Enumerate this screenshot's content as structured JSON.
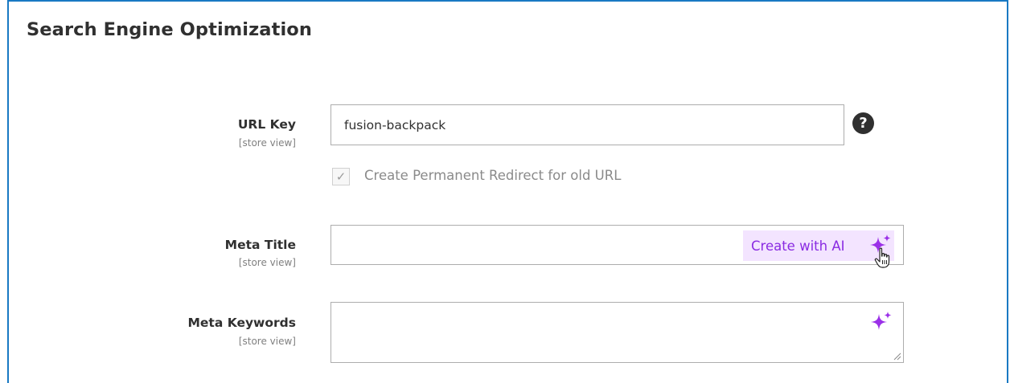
{
  "section": {
    "title": "Search Engine Optimization"
  },
  "fields": {
    "url_key": {
      "label": "URL Key",
      "scope": "[store view]",
      "value": "fusion-backpack",
      "help_icon": "question-circle-icon",
      "redirect_label": "Create Permanent Redirect for old URL",
      "redirect_checked": true
    },
    "meta_title": {
      "label": "Meta Title",
      "scope": "[store view]",
      "value": "",
      "ai_button_label": "Create with AI",
      "ai_icon": "sparkle-icon"
    },
    "meta_keywords": {
      "label": "Meta Keywords",
      "scope": "[store view]",
      "value": "",
      "ai_icon": "sparkle-icon"
    }
  },
  "colors": {
    "panel_border": "#1979c3",
    "ai_accent": "#8a2be2",
    "ai_button_bg": "#f3e4ff",
    "text": "#303030",
    "muted": "#808080"
  }
}
